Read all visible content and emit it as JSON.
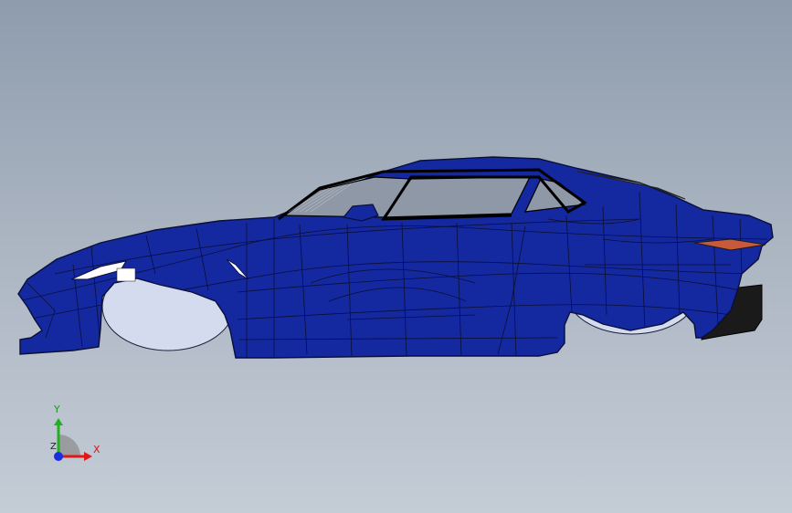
{
  "viewport": {
    "background_top": "#8e9cad",
    "background_bottom": "#c4ccd6"
  },
  "model": {
    "body_color": "#1428a0",
    "edge_color": "#0a0f38",
    "glass_color": "#8f98a6",
    "wheel_well_color": "#d4dbef",
    "taillight_color": "#c85a3a",
    "headlight_color": "#ffffff"
  },
  "triad": {
    "x_label": "X",
    "y_label": "Y",
    "z_label": "Z",
    "x_color": "#e01818",
    "y_color": "#22b022",
    "z_color": "#1830e0"
  }
}
